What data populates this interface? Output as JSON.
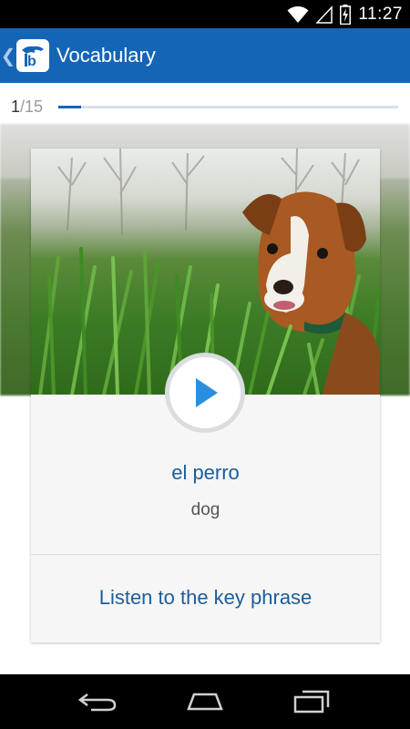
{
  "status_bar": {
    "time": "11:27",
    "icons": [
      "wifi-icon",
      "cell-signal-icon",
      "battery-charging-icon"
    ]
  },
  "app_bar": {
    "title": "Vocabulary",
    "back_icon": "chevron-left-icon",
    "logo_icon": "app-logo-icon",
    "color": "#1565b7"
  },
  "progress": {
    "current": "1",
    "total": "/15",
    "fraction": 0.067
  },
  "card": {
    "image": "puppy-in-grass",
    "play_icon": "play-icon",
    "word": "el perro",
    "translation": "dog",
    "key_phrase_label": "Listen to the key phrase"
  },
  "nav_bar": {
    "buttons": [
      "back-nav-icon",
      "home-nav-icon",
      "recents-nav-icon"
    ]
  }
}
